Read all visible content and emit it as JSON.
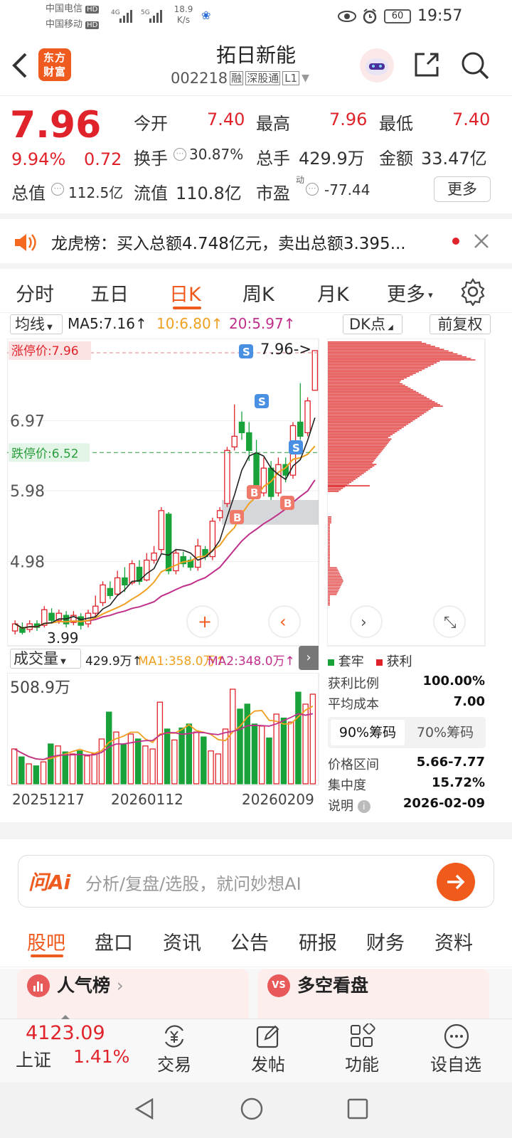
{
  "status": {
    "carrier1": "中国电信",
    "carrier2": "中国移动",
    "hd": "HD",
    "net1": "4G",
    "net2": "5G",
    "speed_val": "18.9",
    "speed_unit": "K/s",
    "battery": "60",
    "time": "19:57"
  },
  "header": {
    "logo": "东方财富",
    "title": "拓日新能",
    "code": "002218",
    "badge1": "融",
    "badge2": "深股通",
    "badge3": "L1"
  },
  "quote": {
    "price": "7.96",
    "pct": "9.94%",
    "chg": "0.72",
    "open_lbl": "今开",
    "open": "7.40",
    "high_lbl": "最高",
    "high": "7.96",
    "low_lbl": "最低",
    "low": "7.40",
    "turn_lbl": "换手",
    "turn": "30.87%",
    "vol_lbl": "总手",
    "vol": "429.9万",
    "amt_lbl": "金额",
    "amt": "33.47亿",
    "cap_lbl": "总值",
    "cap": "112.5亿",
    "flt_lbl": "流值",
    "flt": "110.8亿",
    "pe_lbl": "市盈",
    "pe_sup": "动",
    "pe": "-77.44",
    "more": "更多"
  },
  "notice": {
    "text": "龙虎榜：买入总额4.748亿元，卖出总额3.395..."
  },
  "tabs": [
    "分时",
    "五日",
    "日K",
    "周K",
    "月K",
    "更多"
  ],
  "chart": {
    "ma_btn": "均线",
    "ma5": "MA5:7.16",
    "ma10": "10:6.80",
    "ma20": "20:5.97",
    "dk_btn": "DK点",
    "fq_btn": "前复权",
    "y_labels": [
      "6.97",
      "5.98",
      "4.98"
    ],
    "limit_up": "涨停价:7.96",
    "limit_down": "跌停价:6.52",
    "last_tag": "7.96->",
    "low_tag": "3.99",
    "low_tag2": "3.99",
    "vol_btn": "成交量",
    "vol_val": "429.9万",
    "vol_ma1": "MA1:358.0万",
    "vol_ma2": "MA2:348.0万",
    "vol_max": "508.9万",
    "dates": [
      "20251217",
      "20260112",
      "20260209"
    ],
    "colors": {
      "up": "#e0232b",
      "down": "#19a23a",
      "ma5": "#222222",
      "ma10": "#f0a020",
      "ma20": "#c0308a"
    }
  },
  "chips": {
    "legend_trap": "套牢",
    "legend_profit": "获利",
    "rows": [
      {
        "k": "获利比例",
        "v": "100.00%"
      },
      {
        "k": "平均成本",
        "v": "7.00"
      }
    ],
    "tab90": "90%筹码",
    "tab70": "70%筹码",
    "rows2": [
      {
        "k": "价格区间",
        "v": "5.66-7.77"
      },
      {
        "k": "集中度",
        "v": "15.72%"
      },
      {
        "k": "说明",
        "v": "2026-02-09"
      }
    ]
  },
  "ai": {
    "logo": "问Ai",
    "placeholder": "分析/复盘/选股，就问妙想AI"
  },
  "bottom_tabs": [
    "股吧",
    "盘口",
    "资讯",
    "公告",
    "研报",
    "财务",
    "资料"
  ],
  "cards": {
    "left": "人气榜",
    "right": "多空看盘",
    "vs": "VS"
  },
  "footer": {
    "index_val": "4123.09",
    "index_name": "上证",
    "index_pct": "1.41%",
    "trade": "交易",
    "post": "发帖",
    "func": "功能",
    "fav": "设自选"
  }
}
